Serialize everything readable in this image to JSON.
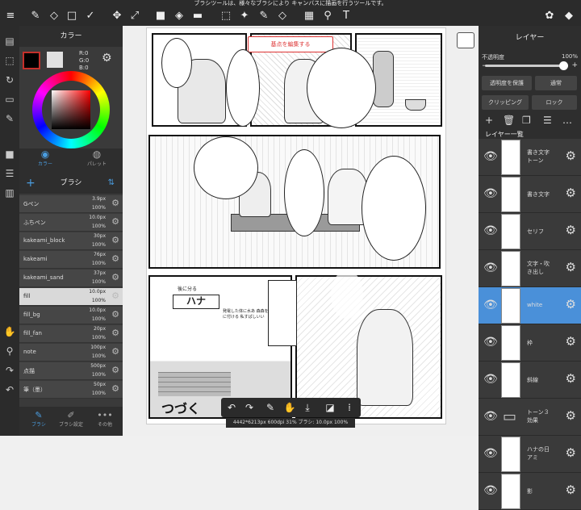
{
  "header": {
    "tooltip": "ブラシツールは、様々なブラシにより キャンバスに描画を行うツールです。"
  },
  "canvas": {
    "edit_button": "基点を編集する",
    "status": "4442*6213px 600dpi 31% ブラシ: 10.0px 100%"
  },
  "color_panel": {
    "title": "カラー",
    "r": "R:0",
    "g": "G:0",
    "b": "B:0",
    "tab_color": "カラー",
    "tab_palette": "パレット",
    "colors": {
      "fg": "#000000",
      "bg": "#ffffff",
      "accent": "#c4302b"
    }
  },
  "brush_panel": {
    "title": "ブラシ",
    "items": [
      {
        "name": "Gペン",
        "size": "3.9px",
        "pct": "100%"
      },
      {
        "name": "ふちペン",
        "size": "10.0px",
        "pct": "100%"
      },
      {
        "name": "kakeami_block",
        "size": "30px",
        "pct": "100%"
      },
      {
        "name": "kakeami",
        "size": "76px",
        "pct": "100%"
      },
      {
        "name": "kakeami_sand",
        "size": "37px",
        "pct": "100%"
      },
      {
        "name": "fill",
        "size": "10.0px",
        "pct": "100%"
      },
      {
        "name": "fill_bg",
        "size": "10.0px",
        "pct": "100%"
      },
      {
        "name": "fill_fan",
        "size": "20px",
        "pct": "100%"
      },
      {
        "name": "note",
        "size": "100px",
        "pct": "100%"
      },
      {
        "name": "点描",
        "size": "500px",
        "pct": "100%"
      },
      {
        "name": "筆（墨）",
        "size": "50px",
        "pct": "100%"
      }
    ],
    "tabs": [
      "ブラシ",
      "ブラシ設定",
      "その他"
    ]
  },
  "layer_panel": {
    "title": "レイヤー",
    "opacity_label": "不透明度",
    "opacity_value": "100%",
    "protect": "透明度を保護",
    "blend": "通常",
    "clipping": "クリッピング",
    "lock": "ロック",
    "list_title": "レイヤー一覧",
    "layers": [
      {
        "name": "書き文字トーン"
      },
      {
        "name": "書き文字"
      },
      {
        "name": "セリフ"
      },
      {
        "name": "文字・吹き出し"
      },
      {
        "name": "white"
      },
      {
        "name": "枠"
      },
      {
        "name": "斜線"
      },
      {
        "name": "トーン３効果"
      },
      {
        "name": "ハナの日アミ"
      },
      {
        "name": "影"
      }
    ]
  },
  "manga": {
    "sign_text": "ハナ",
    "sign_sub": "後に分る",
    "end_text": "つづく",
    "caption": "発電した体に水あ 森森を考す 名前に付ける 私すぱしいい"
  }
}
